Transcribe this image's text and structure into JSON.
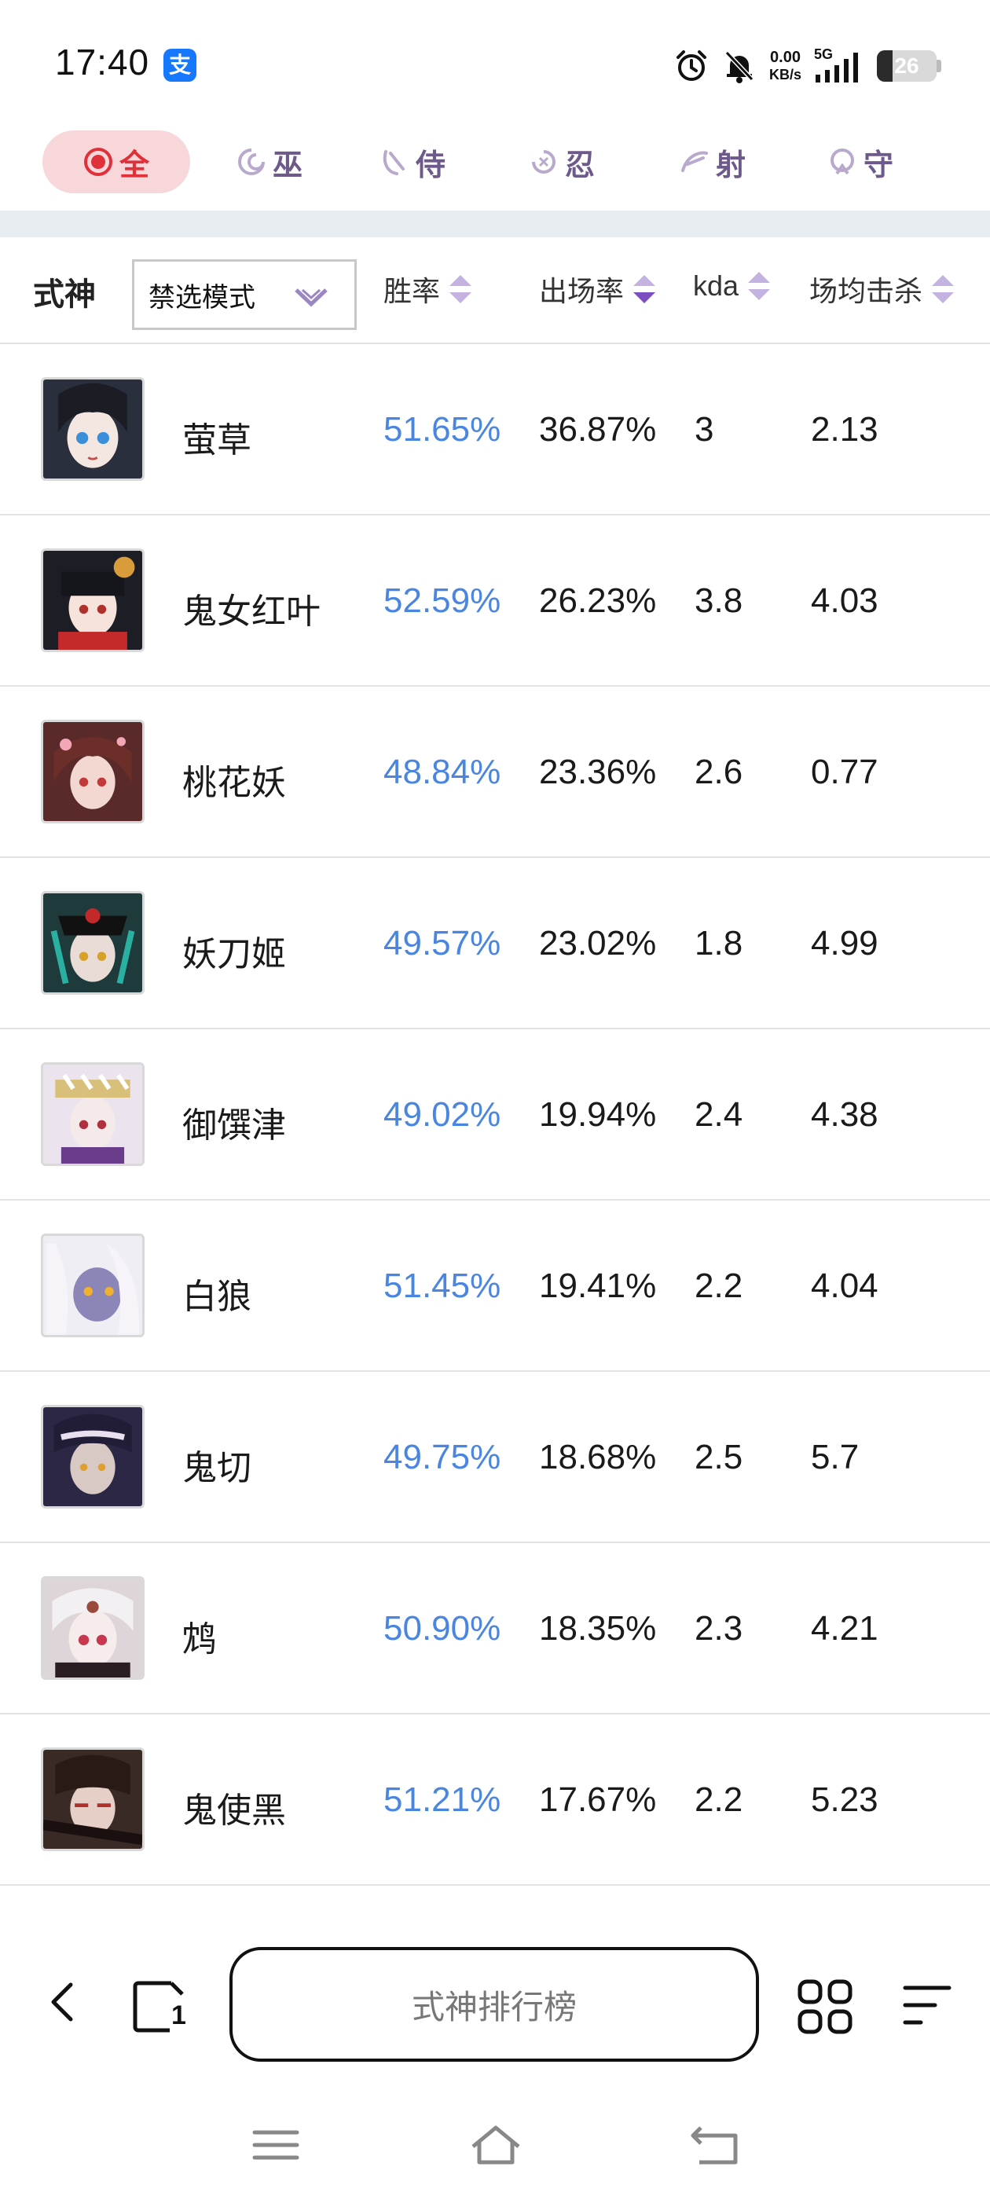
{
  "status_bar": {
    "time": "17:40",
    "alipay_badge": "支",
    "net_speed_value": "0.00",
    "net_speed_unit": "KB/s",
    "network_type": "5G",
    "battery_level": "26",
    "battery_fraction": 0.26
  },
  "role_tabs": [
    {
      "label": "全",
      "icon": "all-role-icon",
      "active": true
    },
    {
      "label": "巫",
      "icon": "mage-role-icon",
      "active": false
    },
    {
      "label": "侍",
      "icon": "warrior-role-icon",
      "active": false
    },
    {
      "label": "忍",
      "icon": "ninja-role-icon",
      "active": false
    },
    {
      "label": "射",
      "icon": "archer-role-icon",
      "active": false
    },
    {
      "label": "守",
      "icon": "guardian-role-icon",
      "active": false
    }
  ],
  "table": {
    "header": {
      "name_col": "式神",
      "mode_select": "禁选模式",
      "winrate_col": "胜率",
      "pickrate_col": "出场率",
      "kda_col": "kda",
      "kills_col": "场均击杀"
    },
    "rows": [
      {
        "name": "萤草",
        "winrate": "51.65%",
        "pickrate": "36.87%",
        "kda": "3",
        "kills": "2.13"
      },
      {
        "name": "鬼女红叶",
        "winrate": "52.59%",
        "pickrate": "26.23%",
        "kda": "3.8",
        "kills": "4.03"
      },
      {
        "name": "桃花妖",
        "winrate": "48.84%",
        "pickrate": "23.36%",
        "kda": "2.6",
        "kills": "0.77"
      },
      {
        "name": "妖刀姬",
        "winrate": "49.57%",
        "pickrate": "23.02%",
        "kda": "1.8",
        "kills": "4.99"
      },
      {
        "name": "御馔津",
        "winrate": "49.02%",
        "pickrate": "19.94%",
        "kda": "2.4",
        "kills": "4.38"
      },
      {
        "name": "白狼",
        "winrate": "51.45%",
        "pickrate": "19.41%",
        "kda": "2.2",
        "kills": "4.04"
      },
      {
        "name": "鬼切",
        "winrate": "49.75%",
        "pickrate": "18.68%",
        "kda": "2.5",
        "kills": "5.7"
      },
      {
        "name": "鸩",
        "winrate": "50.90%",
        "pickrate": "18.35%",
        "kda": "2.3",
        "kills": "4.21"
      },
      {
        "name": "鬼使黑",
        "winrate": "51.21%",
        "pickrate": "17.67%",
        "kda": "2.2",
        "kills": "5.23"
      }
    ]
  },
  "bottom_bar": {
    "search_text": "式神排行榜",
    "tab_count": "1"
  },
  "colors": {
    "active_tab_bg": "#f8d7da",
    "active_tab_text": "#e0303a",
    "role_tab_text": "#6e5a8a",
    "winrate_text": "#4a86e0",
    "sort_icon": "#8e6fc0"
  }
}
